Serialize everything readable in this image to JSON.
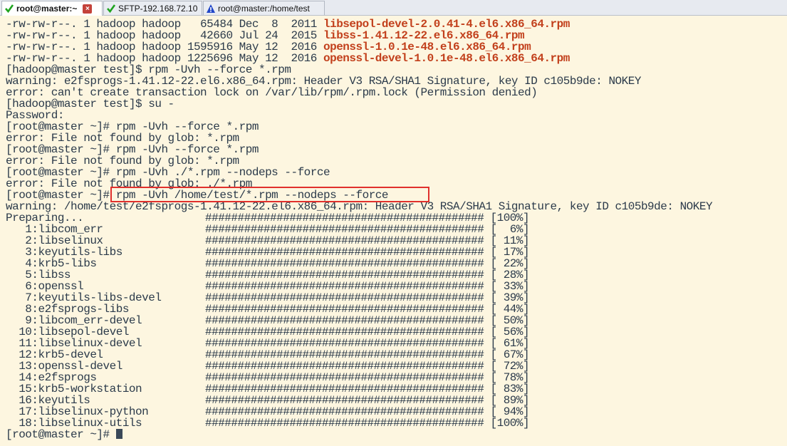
{
  "tabs": [
    {
      "label": "root@master:~",
      "icon": "green-check-icon",
      "active": true,
      "closable": true
    },
    {
      "label": "SFTP-192.168.72.10",
      "icon": "green-check-icon",
      "active": false,
      "closable": false
    },
    {
      "label": "root@master:/home/test",
      "icon": "warning-triangle-icon",
      "active": false,
      "closable": false
    }
  ],
  "listing": [
    {
      "prefix": "-rw-rw-r--. 1 hadoop hadoop   65484 Dec  8  2011 ",
      "file": "libsepol-devel-2.0.41-4.el6.x86_64.rpm"
    },
    {
      "prefix": "-rw-rw-r--. 1 hadoop hadoop   42660 Jul 24  2015 ",
      "file": "libss-1.41.12-22.el6.x86_64.rpm"
    },
    {
      "prefix": "-rw-rw-r--. 1 hadoop hadoop 1595916 May 12  2016 ",
      "file": "openssl-1.0.1e-48.el6.x86_64.rpm"
    },
    {
      "prefix": "-rw-rw-r--. 1 hadoop hadoop 1225696 May 12  2016 ",
      "file": "openssl-devel-1.0.1e-48.el6.x86_64.rpm"
    }
  ],
  "output": [
    "[hadoop@master test]$ rpm -Uvh --force *.rpm",
    "warning: e2fsprogs-1.41.12-22.el6.x86_64.rpm: Header V3 RSA/SHA1 Signature, key ID c105b9de: NOKEY",
    "error: can't create transaction lock on /var/lib/rpm/.rpm.lock (Permission denied)",
    "[hadoop@master test]$ su -",
    "Password:",
    "[root@master ~]# rpm -Uvh --force *.rpm",
    "error: File not found by glob: *.rpm",
    "[root@master ~]# rpm -Uvh --force *.rpm",
    "error: File not found by glob: *.rpm",
    "[root@master ~]# rpm -Uvh ./*.rpm --nodeps --force",
    "error: File not found by glob: ./*.rpm",
    "[root@master ~]# rpm -Uvh /home/test/*.rpm --nodeps --force",
    "warning: /home/test/e2fsprogs-1.41.12-22.el6.x86_64.rpm: Header V3 RSA/SHA1 Signature, key ID c105b9de: NOKEY"
  ],
  "progress_bar": "###########################################",
  "progress": [
    {
      "label": "Preparing...",
      "percent": "[100%]"
    },
    {
      "label": "   1:libcom_err",
      "percent": "[  6%]"
    },
    {
      "label": "   2:libselinux",
      "percent": "[ 11%]"
    },
    {
      "label": "   3:keyutils-libs",
      "percent": "[ 17%]"
    },
    {
      "label": "   4:krb5-libs",
      "percent": "[ 22%]"
    },
    {
      "label": "   5:libss",
      "percent": "[ 28%]"
    },
    {
      "label": "   6:openssl",
      "percent": "[ 33%]"
    },
    {
      "label": "   7:keyutils-libs-devel",
      "percent": "[ 39%]"
    },
    {
      "label": "   8:e2fsprogs-libs",
      "percent": "[ 44%]"
    },
    {
      "label": "   9:libcom_err-devel",
      "percent": "[ 50%]"
    },
    {
      "label": "  10:libsepol-devel",
      "percent": "[ 56%]"
    },
    {
      "label": "  11:libselinux-devel",
      "percent": "[ 61%]"
    },
    {
      "label": "  12:krb5-devel",
      "percent": "[ 67%]"
    },
    {
      "label": "  13:openssl-devel",
      "percent": "[ 72%]"
    },
    {
      "label": "  14:e2fsprogs",
      "percent": "[ 78%]"
    },
    {
      "label": "  15:krb5-workstation",
      "percent": "[ 83%]"
    },
    {
      "label": "  16:keyutils",
      "percent": "[ 89%]"
    },
    {
      "label": "  17:libselinux-python",
      "percent": "[ 94%]"
    },
    {
      "label": "  18:libselinux-utils",
      "percent": "[100%]"
    }
  ],
  "final_prompt": "[root@master ~]# ",
  "colors": {
    "background": "#fdf6e0",
    "text": "#2b3a4a",
    "rpm_file": "#c2401c",
    "highlight": "#e0302c"
  }
}
